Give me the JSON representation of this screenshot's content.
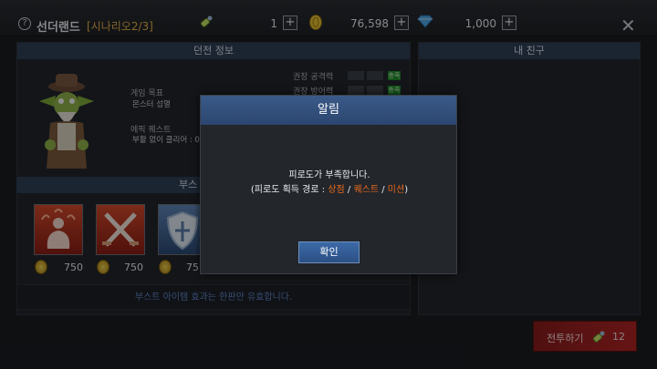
{
  "header": {
    "title": "선더랜드",
    "subtitle": "[시나리오2/3]",
    "help_icon": "question-icon",
    "resources": [
      {
        "icon": "fatigue-potion-icon",
        "value": "1"
      },
      {
        "icon": "gold-coin-icon",
        "value": "76,598"
      },
      {
        "icon": "blue-gem-icon",
        "value": "1,000"
      }
    ],
    "close_icon": "close-icon"
  },
  "dungeon": {
    "title": "던전 정보",
    "goal_label": "게임 목표",
    "goal_value": "몬스터 섬멸",
    "epic_label": "에픽 퀘스트",
    "epic_value": "부활 없이 클리어 : 0",
    "stats": [
      {
        "label": "권장 공격력",
        "badge": "충족"
      },
      {
        "label": "권장 방어력",
        "badge": "충족"
      }
    ]
  },
  "boost": {
    "title": "부스",
    "items": [
      {
        "icon": "strength-boost-icon",
        "cost": "750"
      },
      {
        "icon": "crossed-swords-icon",
        "cost": "750"
      },
      {
        "icon": "shield-icon",
        "cost": "75"
      }
    ],
    "note": "부스트 아이템 효과는 한판만 유효합니다."
  },
  "friends": {
    "title": "내 친구"
  },
  "battle": {
    "label": "전투하기",
    "icon": "fatigue-potion-icon",
    "count": "12"
  },
  "modal": {
    "title": "알림",
    "message": "피로도가 부족합니다.",
    "route_prefix": "(피로도 획득 경로 : ",
    "route_shop": "상점",
    "route_sep1": " / ",
    "route_quest": "퀘스트",
    "route_sep2": " / ",
    "route_mission": "미션",
    "route_suffix": ")",
    "ok_label": "확인"
  },
  "colors": {
    "accent_blue": "#2b4670",
    "highlight": "#e86a1e",
    "battle_red": "#b02424",
    "gold": "#e3b04a"
  }
}
